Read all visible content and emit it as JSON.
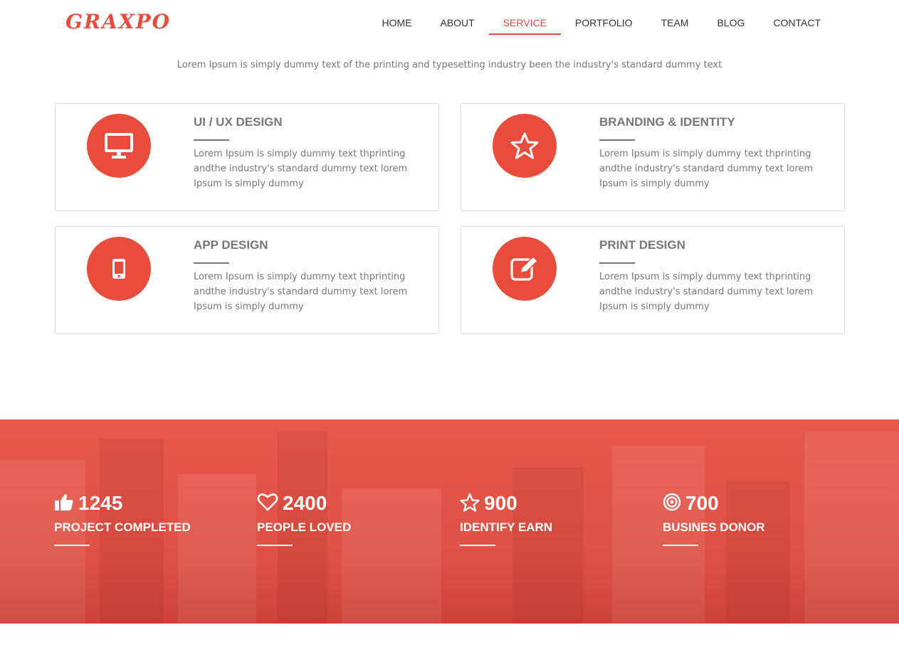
{
  "brand": {
    "logo": "GRAXPO",
    "accent": "#e74c3c"
  },
  "nav": {
    "items": [
      "HOME",
      "ABOUT",
      "SERVICE",
      "PORTFOLIO",
      "TEAM",
      "BLOG",
      "CONTACT"
    ],
    "active": "SERVICE"
  },
  "services": {
    "intro": "Lorem Ipsum is simply dummy text of the printing and typesetting industry been the industry's standard dummy text",
    "cards": [
      {
        "title": "UI / UX DESIGN",
        "icon": "desktop-icon",
        "desc": "Lorem Ipsum is simply dummy text thprinting andthe industry's standard dummy text lorem Ipsum is simply dummy"
      },
      {
        "title": "BRANDING & IDENTITY",
        "icon": "star-icon",
        "desc": "Lorem Ipsum is simply dummy text thprinting andthe industry's standard dummy text lorem Ipsum is simply dummy"
      },
      {
        "title": "APP DESIGN",
        "icon": "mobile-icon",
        "desc": "Lorem Ipsum is simply dummy text thprinting andthe industry's standard dummy text lorem Ipsum is simply dummy"
      },
      {
        "title": "PRINT DESIGN",
        "icon": "edit-icon",
        "desc": "Lorem Ipsum is simply dummy text thprinting andthe industry's standard dummy text lorem Ipsum is simply dummy"
      }
    ]
  },
  "stats": [
    {
      "icon": "thumbs-up-icon",
      "value": "1245",
      "label": "PROJECT COMPLETED"
    },
    {
      "icon": "heart-icon",
      "value": "2400",
      "label": "PEOPLE LOVED"
    },
    {
      "icon": "star-outline-icon",
      "value": "900",
      "label": "IDENTIFY EARN"
    },
    {
      "icon": "target-icon",
      "value": "700",
      "label": "BUSINES DONOR"
    }
  ]
}
